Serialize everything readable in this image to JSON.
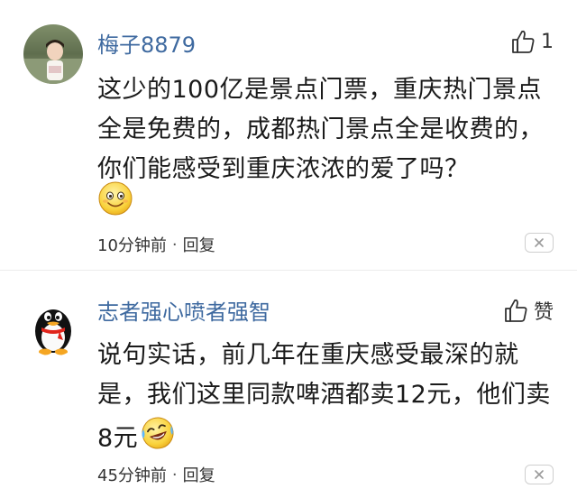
{
  "comments": [
    {
      "username": "梅子8879",
      "like_count": "1",
      "text": "这少的100亿是景点门票，重庆热门景点全是免费的，成都热门景点全是收费的，你们能感受到重庆浓浓的爱了吗？",
      "emoji": "smile-emoji",
      "time": "10分钟前",
      "separator": "·",
      "reply_label": "回复"
    },
    {
      "username": "志者强心喷者强智",
      "like_label": "赞",
      "text": "说句实话，前几年在重庆感受最深的就是，我们这里同款啤酒都卖12元，他们卖8元",
      "emoji": "laughing-tears-emoji",
      "time": "45分钟前",
      "separator": "·",
      "reply_label": "回复"
    }
  ],
  "colors": {
    "username": "#3f6aa0",
    "text": "#1a1a1a",
    "meta": "#333333",
    "divider": "#ececec"
  }
}
